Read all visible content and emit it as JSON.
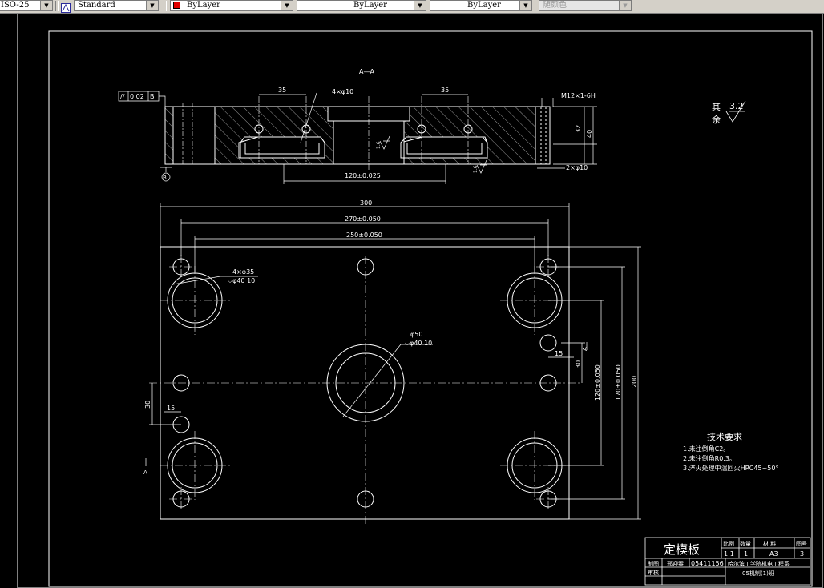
{
  "toolbar": {
    "dimstyle": "ISO-25",
    "textstyle": "Standard",
    "layer": "ByLayer",
    "linetype": "ByLayer",
    "lineweight": "ByLayer",
    "plotstyle": "随颜色"
  },
  "drawing": {
    "section_label": "A—A",
    "section": {
      "parallelism_symbol": "//",
      "parallelism_value": "0.02",
      "parallelism_datum": "B",
      "datum_label": "B",
      "dim_35_left": "35",
      "dim_35_right": "35",
      "holes_4x10": "4×φ10",
      "thread": "M12×1-6H",
      "dim_32": "32",
      "dim_40": "40",
      "dim_120": "120±0.025",
      "holes_2x10": "2×φ10",
      "rough_1": "1.6",
      "rough_2": "1.6"
    },
    "plan": {
      "dim_300": "300",
      "dim_270": "270±0.050",
      "dim_250": "250±0.050",
      "dim_200": "200",
      "dim_170": "170±0.050",
      "dim_120": "120±0.050",
      "dim_30_right": "30",
      "dim_15_right": "15",
      "dim_30_left": "30",
      "dim_15_left": "15",
      "holes_4x35": "4×φ35",
      "holes_4x35_depth": "⌵φ40  10",
      "hole_50": "φ50",
      "hole_50_depth": "⌵φ40  10",
      "cut_a_right": "A",
      "cut_a_left": "A"
    },
    "roughness_note": {
      "line1": "其",
      "line2": "余",
      "value": "3.2"
    },
    "tech": {
      "title": "技术要求",
      "items": [
        "1.未注倒角C2。",
        "2.未注倒角R0.3。",
        "3.淬火处理中温回火HRC45~50°"
      ]
    },
    "title_block": {
      "name": "定模板",
      "h_scale": "比例",
      "h_qty": "数量",
      "h_material": "材    料",
      "h_no": "图号",
      "scale": "1:1",
      "qty": "1",
      "material": "A3",
      "no": "3",
      "drawn_label": "制图",
      "drawn_by": "邢迎春",
      "student_no": "05411156",
      "school": "哈尔滨工学院机电工程系",
      "class": "05机制(1)班",
      "check_label": "审核"
    }
  }
}
